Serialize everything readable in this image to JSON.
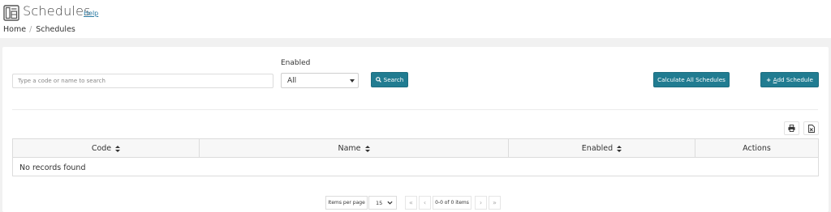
{
  "header": {
    "title": "Schedules",
    "help_label": "Help",
    "app_icon": "schedule-icon"
  },
  "breadcrumb": {
    "items": [
      "Home",
      "Schedules"
    ]
  },
  "filters": {
    "search_placeholder": "Type a code or name to search",
    "search_value": "",
    "enabled_label": "Enabled",
    "enabled_selected": "All",
    "search_button": "Search"
  },
  "actions": {
    "calculate_all": "Calculate All Schedules",
    "add_schedule_prefix": "+ ",
    "add_schedule_accel": "A",
    "add_schedule_rest": "dd Schedule"
  },
  "toolbar": {
    "print_icon": "print-icon",
    "excel_icon": "excel-export-icon"
  },
  "table": {
    "columns": [
      "Code",
      "Name",
      "Enabled",
      "Actions"
    ],
    "empty_text": "No records found"
  },
  "pagination": {
    "items_per_page_label": "Items per page",
    "items_per_page_value": "15",
    "first": "«",
    "prev": "‹",
    "info": "0-0 of 0 items",
    "next": "›",
    "last": "»"
  },
  "colors": {
    "accent": "#217c91",
    "link": "#2a7aa3",
    "background_band": "#f1f1f1"
  }
}
